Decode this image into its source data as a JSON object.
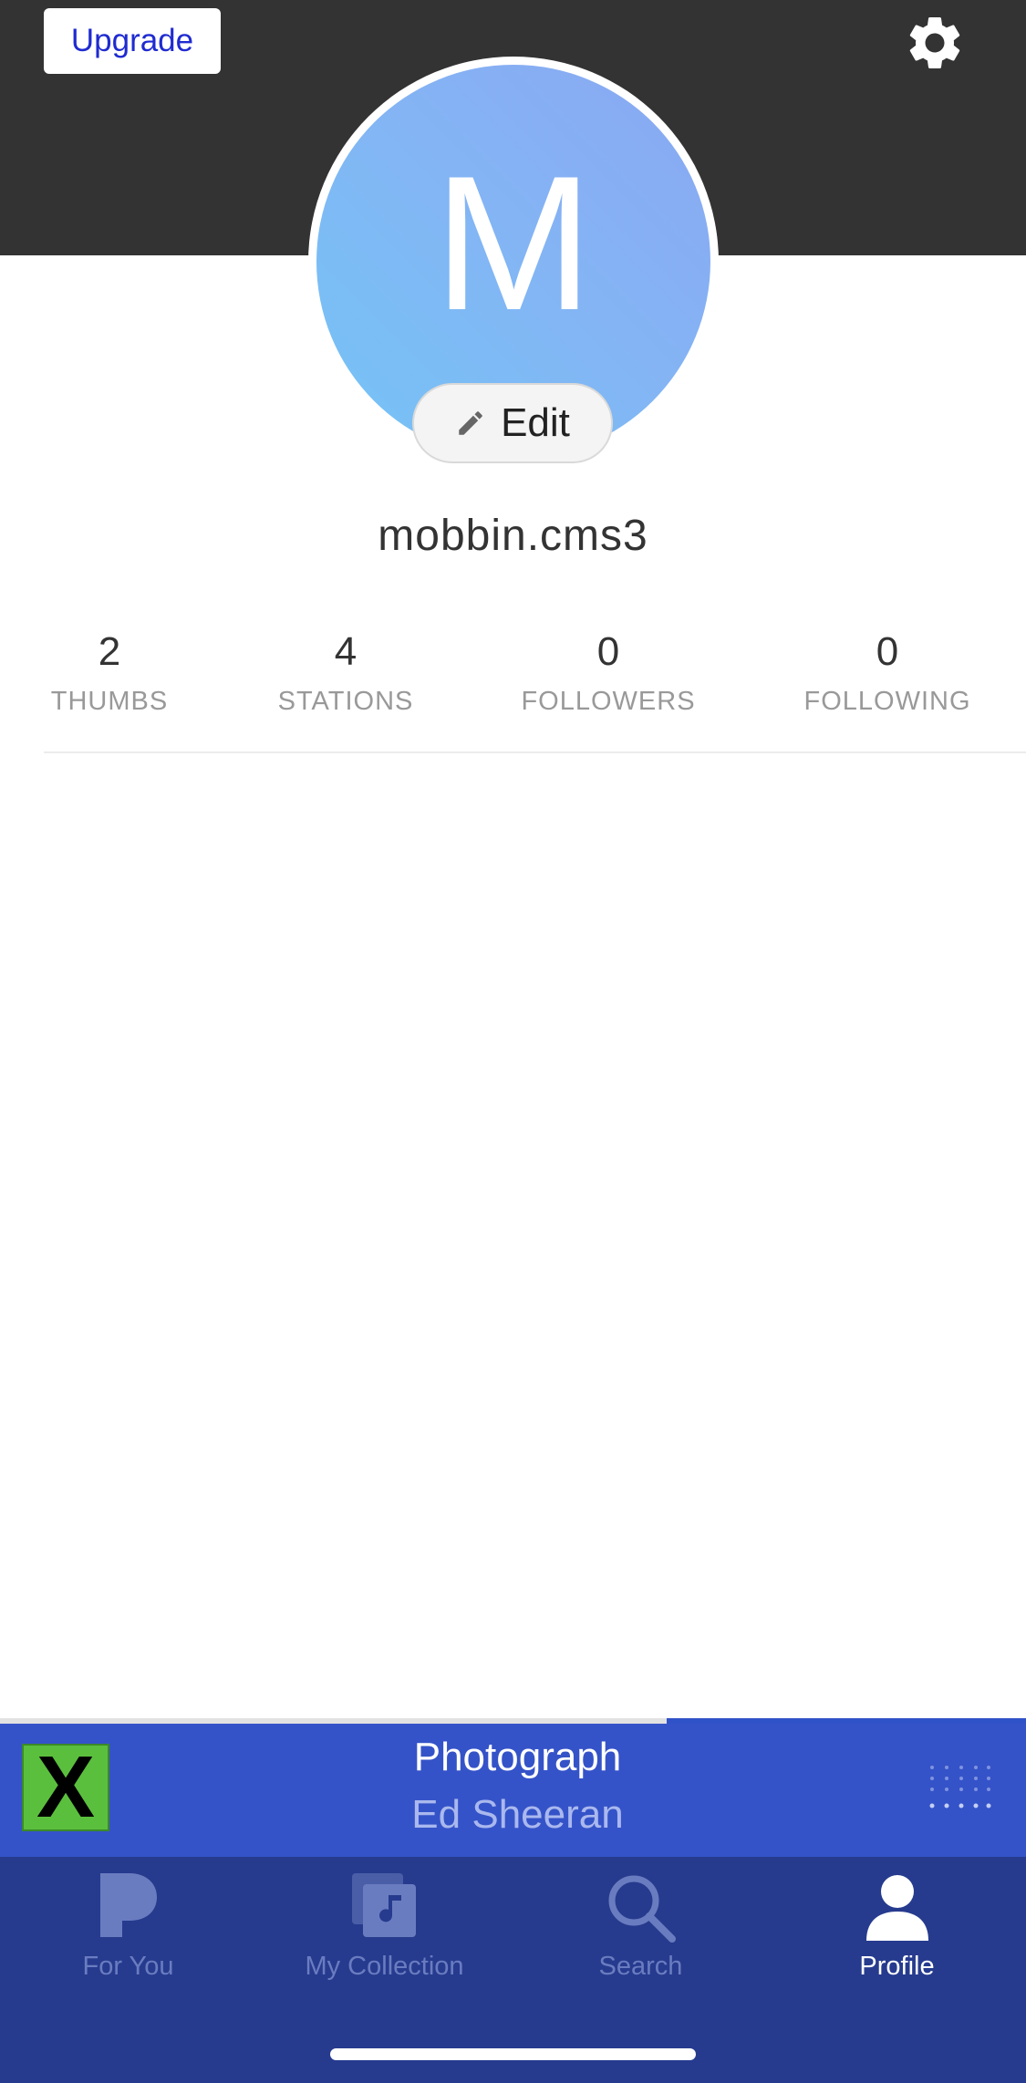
{
  "header": {
    "upgrade_label": "Upgrade",
    "settings_icon": "gear-icon"
  },
  "profile": {
    "avatar_initial": "M",
    "edit_label": "Edit",
    "edit_icon": "pencil-icon",
    "username": "mobbin.cms3"
  },
  "stats": [
    {
      "value": "2",
      "label": "THUMBS"
    },
    {
      "value": "4",
      "label": "STATIONS"
    },
    {
      "value": "0",
      "label": "FOLLOWERS"
    },
    {
      "value": "0",
      "label": "FOLLOWING"
    }
  ],
  "now_playing": {
    "title": "Photograph",
    "artist": "Ed Sheeran",
    "album_art_text": "X",
    "progress_fraction": 0.65
  },
  "tabs": [
    {
      "label": "For You",
      "icon": "pandora-p-icon",
      "active": false
    },
    {
      "label": "My Collection",
      "icon": "collection-icon",
      "active": false
    },
    {
      "label": "Search",
      "icon": "search-icon",
      "active": false
    },
    {
      "label": "Profile",
      "icon": "profile-icon",
      "active": true
    }
  ],
  "colors": {
    "header_bg": "#333333",
    "accent_blue": "#1f2bd0",
    "now_playing_bg": "#3553c8",
    "tab_bar_bg": "#263b8e",
    "tab_inactive": "#6a7cc0",
    "tab_active": "#ffffff"
  }
}
